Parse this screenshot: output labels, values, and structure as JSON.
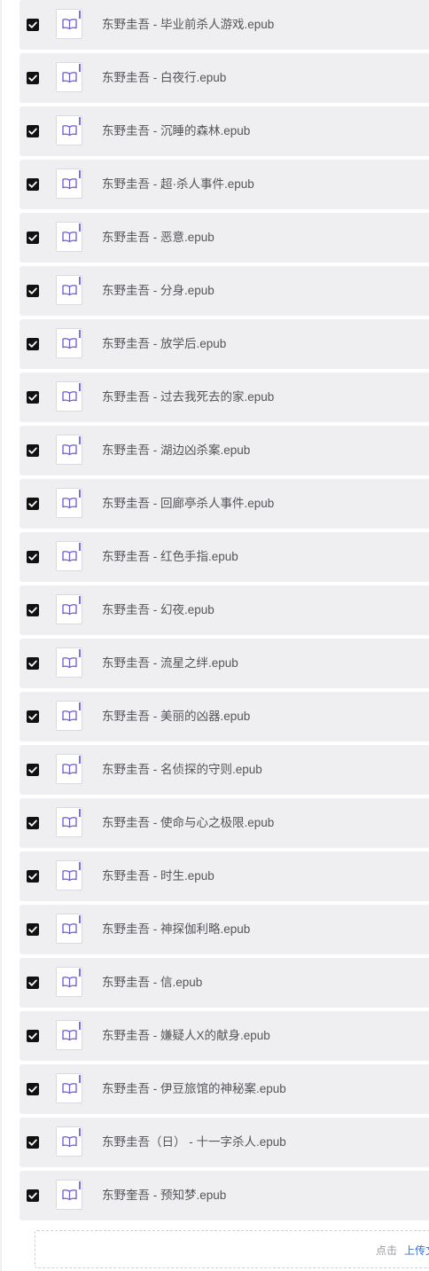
{
  "files": [
    {
      "name": "东野圭吾 - 毕业前杀人游戏.epub",
      "checked": true
    },
    {
      "name": "东野圭吾 - 白夜行.epub",
      "checked": true
    },
    {
      "name": "东野圭吾 - 沉睡的森林.epub",
      "checked": true
    },
    {
      "name": "东野圭吾 - 超·杀人事件.epub",
      "checked": true
    },
    {
      "name": "东野圭吾 - 恶意.epub",
      "checked": true
    },
    {
      "name": "东野圭吾 - 分身.epub",
      "checked": true
    },
    {
      "name": "东野圭吾 - 放学后.epub",
      "checked": true
    },
    {
      "name": "东野圭吾 - 过去我死去的家.epub",
      "checked": true
    },
    {
      "name": "东野圭吾 - 湖边凶杀案.epub",
      "checked": true
    },
    {
      "name": "东野圭吾 - 回廊亭杀人事件.epub",
      "checked": true
    },
    {
      "name": "东野圭吾 - 红色手指.epub",
      "checked": true
    },
    {
      "name": "东野圭吾 - 幻夜.epub",
      "checked": true
    },
    {
      "name": "东野圭吾 - 流星之绊.epub",
      "checked": true
    },
    {
      "name": "东野圭吾 - 美丽的凶器.epub",
      "checked": true
    },
    {
      "name": "东野圭吾 - 名侦探的守则.epub",
      "checked": true
    },
    {
      "name": "东野圭吾 - 使命与心之极限.epub",
      "checked": true
    },
    {
      "name": "东野圭吾 - 时生.epub",
      "checked": true
    },
    {
      "name": "东野圭吾 - 神探伽利略.epub",
      "checked": true
    },
    {
      "name": "东野圭吾 - 信.epub",
      "checked": true
    },
    {
      "name": "东野圭吾 - 嫌疑人X的献身.epub",
      "checked": true
    },
    {
      "name": "东野圭吾 - 伊豆旅馆的神秘案.epub",
      "checked": true
    },
    {
      "name": "东野圭吾（日） - 十一字杀人.epub",
      "checked": true
    },
    {
      "name": "东野奎吾 - 预知梦.epub",
      "checked": true
    }
  ],
  "upload": {
    "hint": "点击",
    "link_label": "上传文"
  },
  "icons": {
    "checkbox": "checkbox-checked-icon",
    "file": "epub-book-icon"
  },
  "colors": {
    "row_background": "#efeff2",
    "checkbox": "#111111",
    "icon_accent": "#7c6ee0",
    "link": "#3c6fd0"
  }
}
